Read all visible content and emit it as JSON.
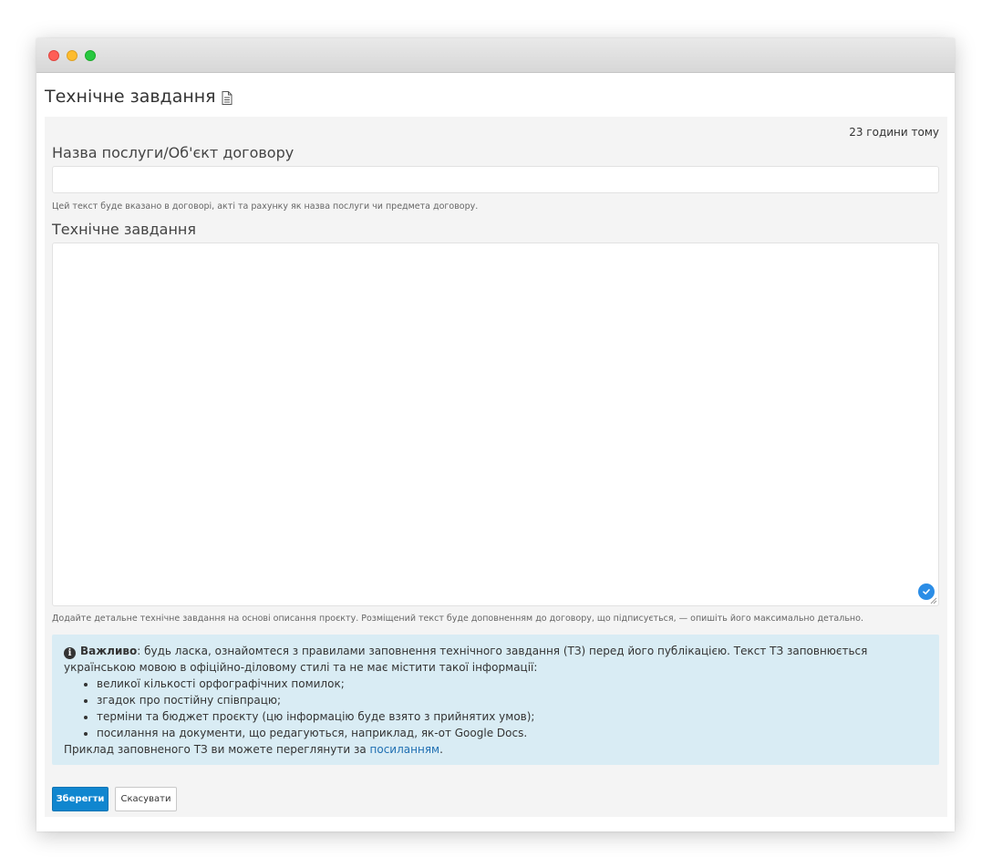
{
  "page": {
    "title": "Технічне завдання",
    "title_icon": "document-icon"
  },
  "form": {
    "updated": "23 години тому",
    "service_name": {
      "label": "Назва послуги/Об'єкт договору",
      "value": "",
      "help": "Цей текст буде вказано в договорі, акті та рахунку як назва послуги чи предмета договору."
    },
    "spec": {
      "label": "Технічне завдання",
      "value": "",
      "help": "Додайте детальне технічне завдання на основі описання проєкту. Розміщений текст буде доповненням до договору, що підписується, — опишіть його максимально детально."
    }
  },
  "notice": {
    "title": "Важливо",
    "intro": ": будь ласка, ознайомтеся з правилами заповнення технічного завдання (ТЗ) перед його публікацією. Текст ТЗ заповнюється українською мовою в офіційно-діловому стилі та не має містити такої інформації:",
    "items": [
      "великої кількості орфографічних помилок;",
      "згадок про постійну співпрацю;",
      "терміни та бюджет проєкту (цю інформацію буде взято з прийнятих умов);",
      "посилання на документи, що редагуються, наприклад, як-от Google Docs."
    ],
    "footer_prefix": "Приклад заповненого ТЗ ви можете переглянути за ",
    "footer_link": "посиланням",
    "footer_suffix": "."
  },
  "buttons": {
    "save": "Зберегти",
    "cancel": "Скасувати"
  },
  "colors": {
    "primary": "#1086cf",
    "notice_bg": "#d9ecf4",
    "link": "#1f6fb2",
    "panel_bg": "#f4f4f4"
  }
}
